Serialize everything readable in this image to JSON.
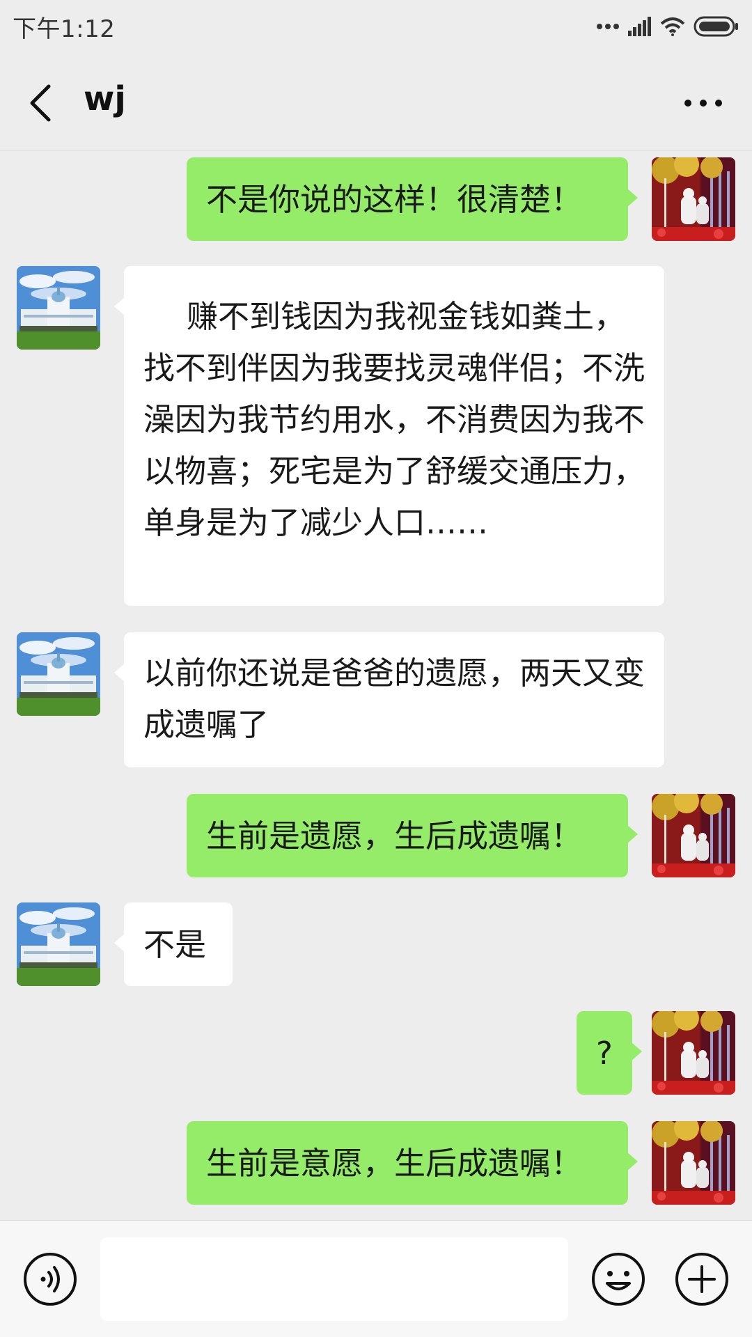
{
  "status_bar": {
    "time": "下午1:12",
    "icons": [
      "more-dots-icon",
      "signal-icon",
      "wifi-icon",
      "battery-icon"
    ]
  },
  "header": {
    "title": "wj",
    "back_icon": "back-chevron-icon",
    "more_icon": "more-icon"
  },
  "messages": [
    {
      "side": "sent",
      "text": "不是你说的这样！很清楚！"
    },
    {
      "side": "received",
      "text": "赚不到钱因为我视金钱如粪土，找不到伴因为我要找灵魂伴侣；不洗澡因为我节约用水，不消费因为我不以物喜；死宅是为了舒缓交通压力，单身是为了减少人口……"
    },
    {
      "side": "received",
      "text": "以前你还说是爸爸的遗愿，两天又变成遗嘱了"
    },
    {
      "side": "sent",
      "text": "生前是遗愿，生后成遗嘱！"
    },
    {
      "side": "received",
      "text": "不是"
    },
    {
      "side": "sent",
      "text": "?"
    },
    {
      "side": "sent",
      "text": "生前是意愿，生后成遗嘱！"
    }
  ],
  "input_bar": {
    "placeholder": "",
    "icons": [
      "voice-icon",
      "emoji-icon",
      "plus-icon"
    ]
  },
  "colors": {
    "background": "#ededed",
    "sent_bubble": "#95ec69",
    "received_bubble": "#ffffff"
  }
}
